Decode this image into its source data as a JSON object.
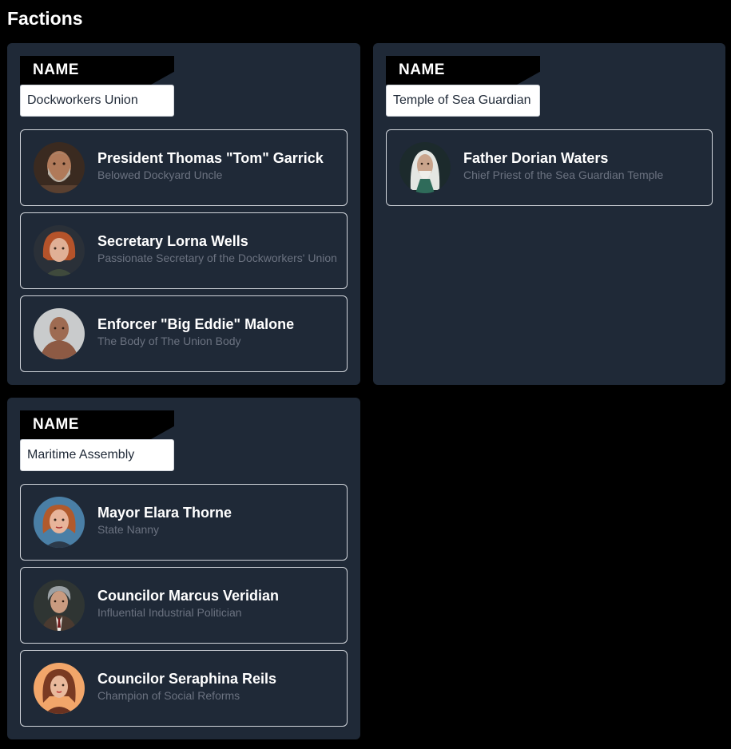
{
  "page": {
    "title": "Factions"
  },
  "factions": [
    {
      "name_label": "NAME",
      "name_value": "Dockworkers Union",
      "members": [
        {
          "name": "President Thomas \"Tom\" Garrick",
          "title": "Belowed Dockyard Uncle",
          "avatar": "portrait-old-bearded-man-icon"
        },
        {
          "name": "Secretary Lorna Wells",
          "title": "Passionate Secretary of the Dockworkers' Union",
          "avatar": "portrait-red-haired-woman-icon"
        },
        {
          "name": "Enforcer \"Big Eddie\" Malone",
          "title": "The Body of The Union Body",
          "avatar": "portrait-bald-muscular-man-icon"
        }
      ]
    },
    {
      "name_label": "NAME",
      "name_value": "Temple of Sea Guardian",
      "members": [
        {
          "name": "Father Dorian Waters",
          "title": "Chief Priest of the Sea Guardian Temple",
          "avatar": "portrait-white-haired-priest-icon"
        }
      ]
    },
    {
      "name_label": "NAME",
      "name_value": "Maritime Assembly",
      "members": [
        {
          "name": "Mayor Elara Thorne",
          "title": "State Nanny",
          "avatar": "portrait-auburn-haired-woman-icon"
        },
        {
          "name": "Councilor Marcus Veridian",
          "title": "Influential Industrial Politician",
          "avatar": "portrait-grey-haired-man-suit-icon"
        },
        {
          "name": "Councilor Seraphina Reils",
          "title": "Champion of Social Reforms",
          "avatar": "portrait-brown-haired-woman-icon"
        }
      ]
    }
  ]
}
